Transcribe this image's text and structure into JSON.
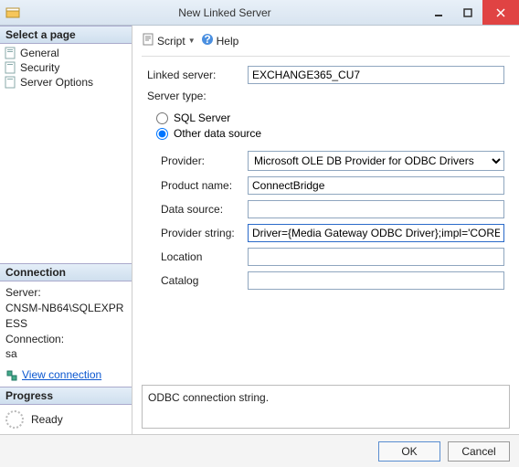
{
  "window": {
    "title": "New Linked Server"
  },
  "toolbar": {
    "script": "Script",
    "help": "Help"
  },
  "sidebar": {
    "select_page_title": "Select a page",
    "pages": [
      {
        "label": "General"
      },
      {
        "label": "Security"
      },
      {
        "label": "Server Options"
      }
    ],
    "connection_title": "Connection",
    "connection": {
      "server_label": "Server:",
      "server_value": "CNSM-NB64\\SQLEXPRESS",
      "conn_label": "Connection:",
      "conn_value": "sa",
      "view_connection": "View connection "
    },
    "progress_title": "Progress",
    "progress_status": "Ready"
  },
  "form": {
    "linked_server_label": "Linked server:",
    "linked_server_value": "EXCHANGE365_CU7",
    "server_type_label": "Server type:",
    "radio_sql": "SQL Server",
    "radio_other": "Other data source",
    "provider_label": "Provider:",
    "provider_value": "Microsoft OLE DB Provider for ODBC Drivers",
    "product_name_label": "Product name:",
    "product_name_value": "ConnectBridge",
    "data_source_label": "Data source:",
    "data_source_value": "",
    "provider_string_label": "Provider string:",
    "provider_string_value": "Driver={Media Gateway ODBC Driver};impl='CORE",
    "location_label": "Location",
    "location_value": "",
    "catalog_label": "Catalog",
    "catalog_value": ""
  },
  "description": "ODBC connection string.",
  "footer": {
    "ok": "OK",
    "cancel": "Cancel"
  }
}
